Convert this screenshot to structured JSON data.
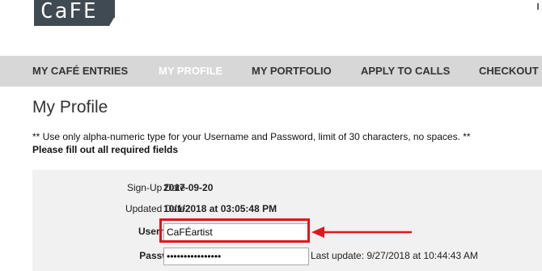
{
  "header": {
    "logo_text": "CaFE"
  },
  "nav": {
    "items": [
      {
        "label": "MY CAFÉ ENTRIES",
        "active": false
      },
      {
        "label": "MY PROFILE",
        "active": true
      },
      {
        "label": "MY PORTFOLIO",
        "active": false
      },
      {
        "label": "APPLY TO CALLS",
        "active": false
      },
      {
        "label": "CHECKOUT",
        "active": false
      }
    ]
  },
  "page": {
    "title": "My Profile",
    "note_line1": "** Use only alpha-numeric type for your Username and Password, limit of 30 characters, no spaces. **",
    "note_line2": "Please fill out all required fields"
  },
  "profile": {
    "signup_label": "Sign-Up Date",
    "signup_value": "2017-09-20",
    "updated_label": "Updated Date",
    "updated_value": "10/1/2018 at 03:05:48 PM",
    "username_label": "Username",
    "username_value": "CaFÉartist",
    "password_label": "Password",
    "password_value": "••••••••••••••••",
    "password_last_update": "Last update: 9/27/2018 at 10:44:43 AM"
  },
  "annotation": {
    "highlight_color": "#e0161b"
  },
  "colors": {
    "nav_bg": "#d7d7d7",
    "nav_active_text": "#ffffff",
    "panel_bg": "#f1f1f1",
    "logo_bg": "#3f4a52"
  }
}
